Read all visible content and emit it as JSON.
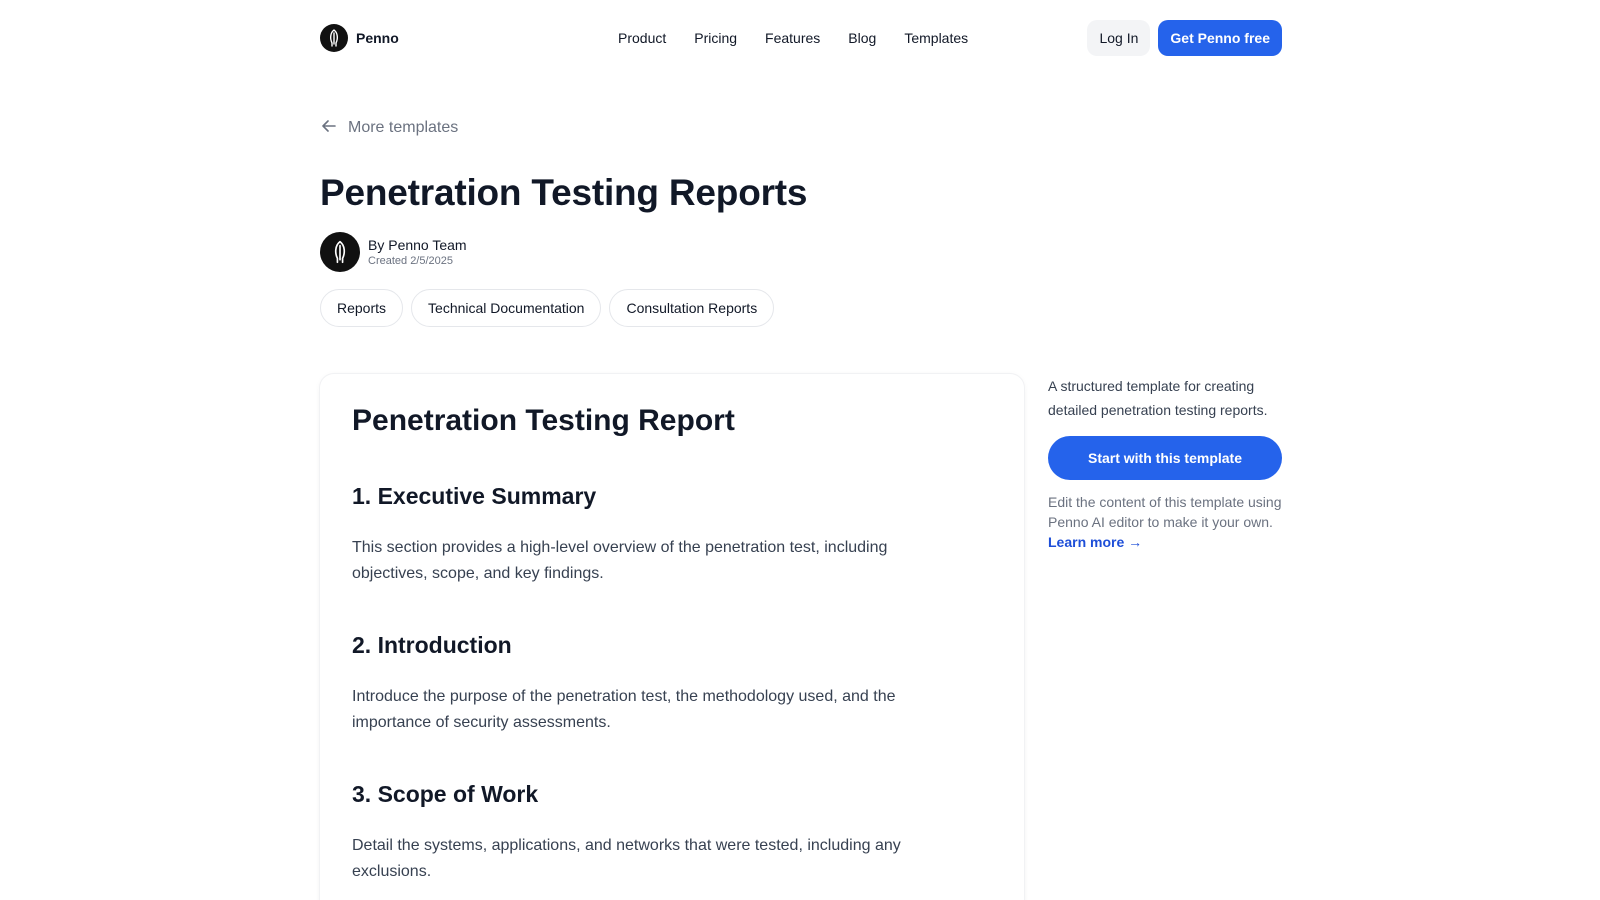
{
  "header": {
    "brand_name": "Penno",
    "nav": [
      "Product",
      "Pricing",
      "Features",
      "Blog",
      "Templates"
    ],
    "login_label": "Log In",
    "cta_label": "Get Penno free"
  },
  "back_link": {
    "label": "More templates"
  },
  "page": {
    "title": "Penetration Testing Reports",
    "author": "By Penno Team",
    "created": "Created 2/5/2025",
    "tags": [
      "Reports",
      "Technical Documentation",
      "Consultation Reports"
    ]
  },
  "document": {
    "title": "Penetration Testing Report",
    "sections": [
      {
        "heading": "1. Executive Summary",
        "body": "This section provides a high-level overview of the penetration test, including objectives, scope, and key findings."
      },
      {
        "heading": "2. Introduction",
        "body": "Introduce the purpose of the penetration test, the methodology used, and the importance of security assessments."
      },
      {
        "heading": "3. Scope of Work",
        "body": "Detail the systems, applications, and networks that were tested, including any exclusions."
      }
    ]
  },
  "sidebar": {
    "description": "A structured template for creating detailed penetration testing reports.",
    "start_label": "Start with this template",
    "note": "Edit the content of this template using Penno AI editor to make it your own.",
    "learn_more": "Learn more →"
  },
  "colors": {
    "accent": "#2563eb",
    "text": "#111827",
    "muted": "#6b7280"
  }
}
